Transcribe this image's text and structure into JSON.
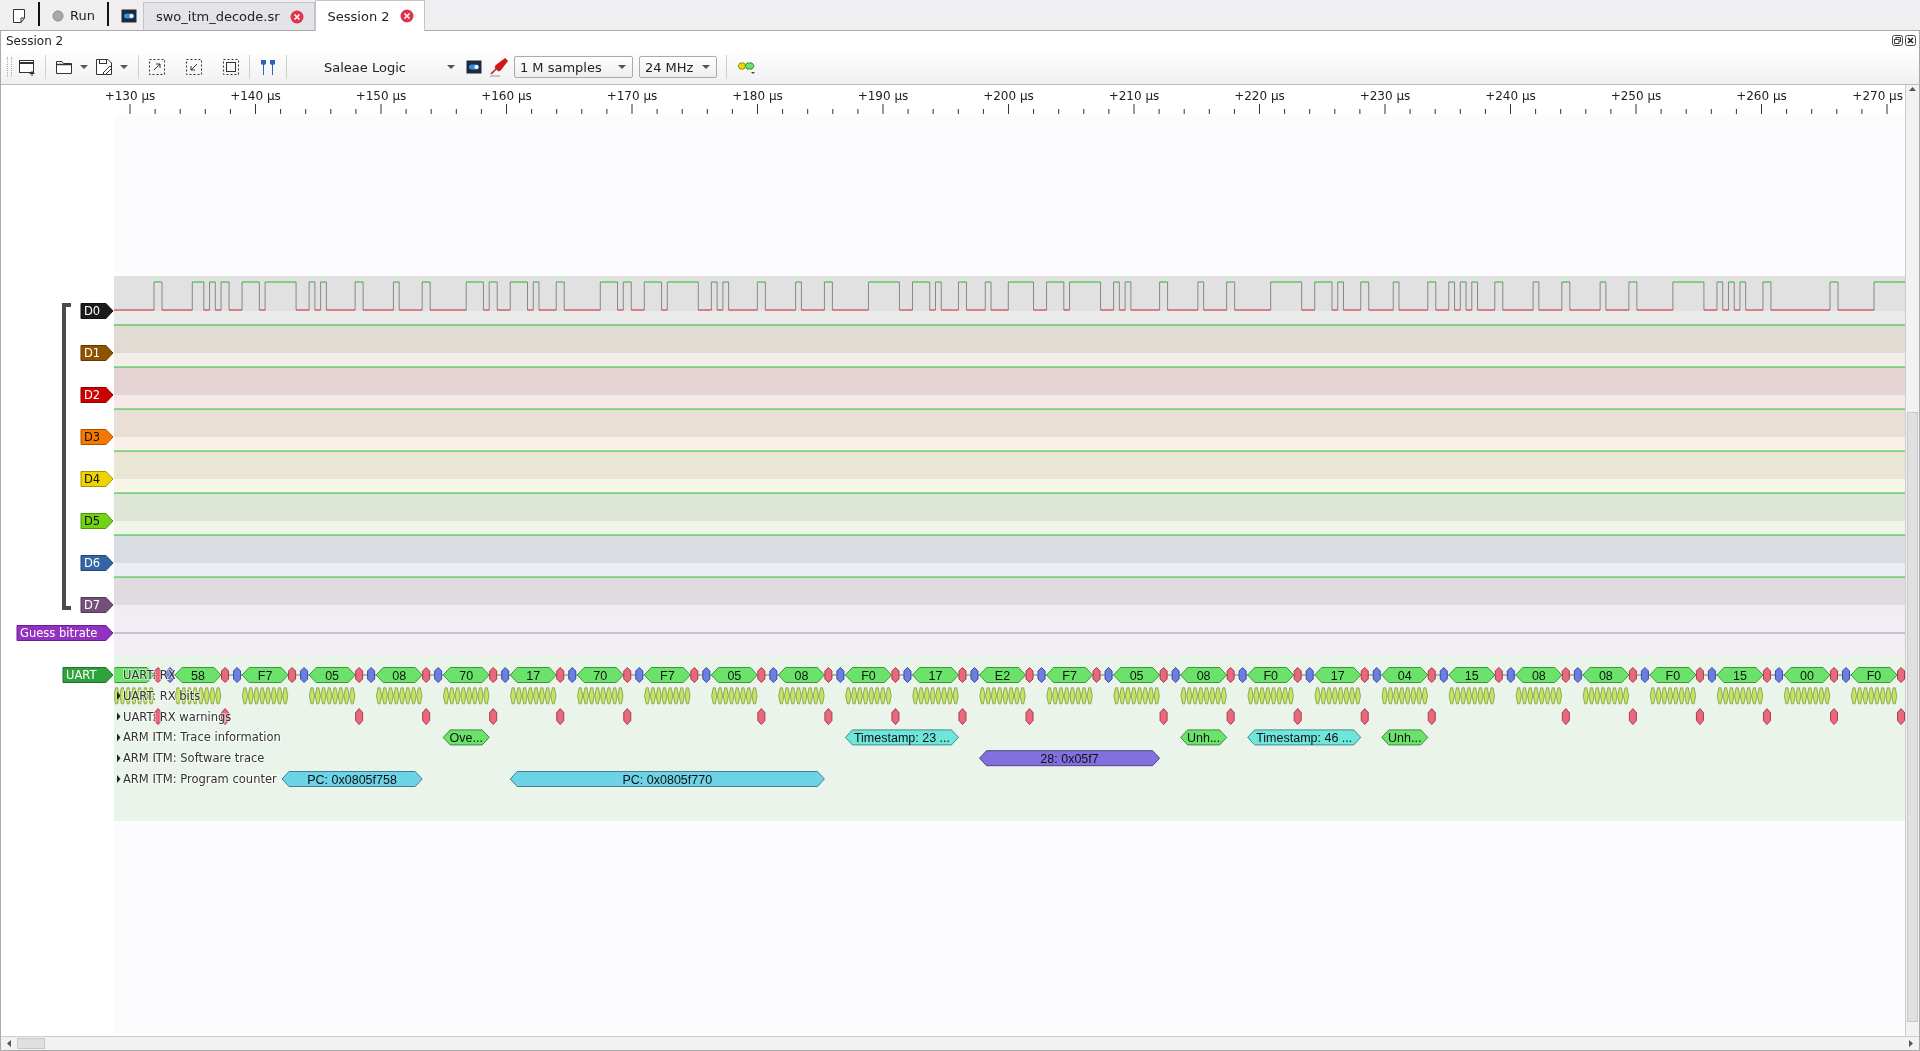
{
  "tabbar": {
    "run_button": "Run"
  },
  "tabs": [
    {
      "label": "swo_itm_decode.sr",
      "selected": false
    },
    {
      "label": "Session 2",
      "selected": true
    }
  ],
  "session": {
    "title": "Session 2",
    "device": "Saleae Logic",
    "samples": "1 M samples",
    "samplerate": "24 MHz"
  },
  "ruler": {
    "labels": [
      "+130 µs",
      "+140 µs",
      "+150 µs",
      "+160 µs",
      "+170 µs",
      "+180 µs",
      "+190 µs",
      "+200 µs",
      "+210 µs",
      "+220 µs",
      "+230 µs",
      "+240 µs",
      "+250 µs",
      "+260 µs",
      "+270 µs"
    ]
  },
  "channels": [
    {
      "name": "D0",
      "color": "#1b1b1b",
      "kind": "active"
    },
    {
      "name": "D1",
      "color": "#8f5202",
      "kind": "flat"
    },
    {
      "name": "D2",
      "color": "#cc0000",
      "kind": "flat"
    },
    {
      "name": "D3",
      "color": "#f57900",
      "kind": "flat"
    },
    {
      "name": "D4",
      "color": "#edd400",
      "kind": "flat"
    },
    {
      "name": "D5",
      "color": "#73d216",
      "kind": "flat"
    },
    {
      "name": "D6",
      "color": "#3465a4",
      "kind": "flat"
    },
    {
      "name": "D7",
      "color": "#75507b",
      "kind": "flat"
    }
  ],
  "decoders": [
    {
      "name": "Guess bitrate",
      "color": "#9332c0",
      "kind": "plain"
    },
    {
      "name": "UART",
      "color": "#2fa23a",
      "kind": "rows",
      "bytes": [
        {
          "warning": true
        },
        {
          "value": "58",
          "warning": true
        },
        {
          "value": "F7",
          "warning": false
        },
        {
          "value": "05",
          "warning": true
        },
        {
          "value": "08",
          "warning": true
        },
        {
          "value": "70",
          "warning": true
        },
        {
          "value": "17",
          "warning": true
        },
        {
          "value": "70",
          "warning": true
        },
        {
          "value": "F7",
          "warning": false
        },
        {
          "value": "05",
          "warning": true
        },
        {
          "value": "08",
          "warning": true
        },
        {
          "value": "F0",
          "warning": true
        },
        {
          "value": "17",
          "warning": true
        },
        {
          "value": "E2",
          "warning": true
        },
        {
          "value": "F7",
          "warning": false
        },
        {
          "value": "05",
          "warning": true
        },
        {
          "value": "08",
          "warning": true
        },
        {
          "value": "F0",
          "warning": true
        },
        {
          "value": "17",
          "warning": true
        },
        {
          "value": "04",
          "warning": true
        },
        {
          "value": "15",
          "warning": false
        },
        {
          "value": "08",
          "warning": true
        },
        {
          "value": "08",
          "warning": true
        },
        {
          "value": "F0",
          "warning": true
        },
        {
          "value": "15",
          "warning": true
        },
        {
          "value": "00",
          "warning": true
        },
        {
          "value": "F0",
          "warning": true
        }
      ],
      "rows": [
        {
          "label": "UART: RX",
          "kind": "bytes"
        },
        {
          "label": "UART: RX bits",
          "kind": "bits"
        },
        {
          "label": "UART: RX warnings",
          "kind": "warnings"
        },
        {
          "label": "ARM ITM: Trace information",
          "kind": "spans",
          "annotations": [
            {
              "text": "Ove...",
              "color": "#6be36b"
            },
            {
              "text": "Timestamp: 23 ...",
              "color": "#6ee6dc"
            },
            {
              "text": "Unh...",
              "color": "#6be36b"
            },
            {
              "text": "Timestamp: 46 ...",
              "color": "#6ee6dc"
            },
            {
              "text": "Unh...",
              "color": "#6be36b"
            }
          ]
        },
        {
          "label": "ARM ITM: Software trace",
          "kind": "spans",
          "annotations": [
            {
              "text": "28: 0x05f7",
              "color": "#8270e0"
            }
          ]
        },
        {
          "label": "ARM ITM: Program counter",
          "kind": "spans",
          "annotations": [
            {
              "text": "PC: 0x0805f758",
              "color": "#6dd3e6"
            },
            {
              "text": "PC: 0x0805f770",
              "color": "#6dd3e6"
            }
          ]
        }
      ]
    }
  ]
}
